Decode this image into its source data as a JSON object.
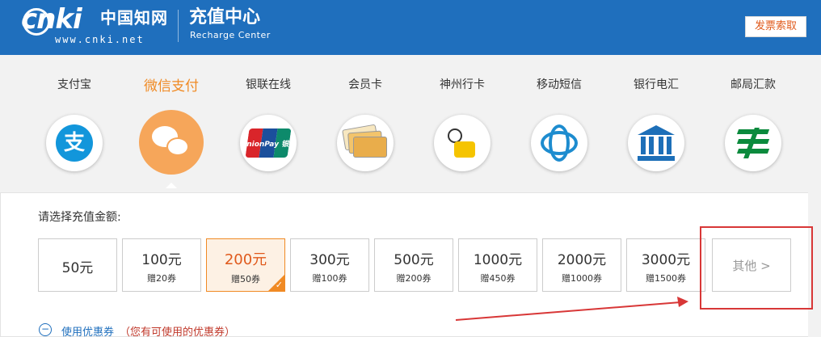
{
  "header": {
    "logo_text": "cnki",
    "logo_cn": "中国知网",
    "logo_url": "www.cnki.net",
    "title": "充值中心",
    "subtitle": "Recharge Center",
    "invoice_button": "发票索取"
  },
  "payment_methods": [
    {
      "label": "支付宝",
      "icon": "alipay-icon",
      "active": false
    },
    {
      "label": "微信支付",
      "icon": "wechat-icon",
      "active": true
    },
    {
      "label": "银联在线",
      "icon": "unionpay-icon",
      "active": false
    },
    {
      "label": "会员卡",
      "icon": "member-card-icon",
      "active": false
    },
    {
      "label": "神州行卡",
      "icon": "shenzhouxing-icon",
      "active": false
    },
    {
      "label": "移动短信",
      "icon": "china-mobile-icon",
      "active": false
    },
    {
      "label": "银行电汇",
      "icon": "bank-icon",
      "active": false
    },
    {
      "label": "邮局汇款",
      "icon": "post-office-icon",
      "active": false
    }
  ],
  "unionpay_text": "UnionPay 银联",
  "amount_section": {
    "title": "请选择充值金额:",
    "amounts": [
      {
        "value": "50元",
        "bonus": ""
      },
      {
        "value": "100元",
        "bonus": "赠20券"
      },
      {
        "value": "200元",
        "bonus": "赠50券",
        "selected": true
      },
      {
        "value": "300元",
        "bonus": "赠100券"
      },
      {
        "value": "500元",
        "bonus": "赠200券"
      },
      {
        "value": "1000元",
        "bonus": "赠450券"
      },
      {
        "value": "2000元",
        "bonus": "赠1000券"
      },
      {
        "value": "3000元",
        "bonus": "赠1500券"
      }
    ],
    "other": "其他 >",
    "check_mark": "✓"
  },
  "coupon": {
    "toggle_icon": "−",
    "label": "使用优惠券",
    "note": "（您有可使用的优惠券）"
  },
  "colors": {
    "header_bg": "#1f6fbd",
    "accent_orange": "#f08a24",
    "annotation_red": "#d83737"
  }
}
